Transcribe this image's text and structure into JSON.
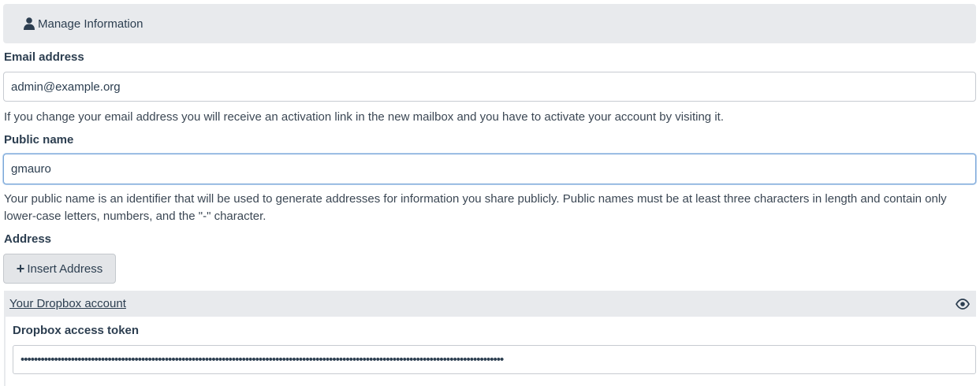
{
  "header": {
    "title": "Manage Information",
    "icon": "user-icon"
  },
  "email": {
    "label": "Email address",
    "value": "admin@example.org",
    "help": "If you change your email address you will receive an activation link in the new mailbox and you have to activate your account by visiting it."
  },
  "public_name": {
    "label": "Public name",
    "value": "gmauro",
    "help": "Your public name is an identifier that will be used to generate addresses for information you share publicly. Public names must be at least three characters in length and contain only lower-case letters, numbers, and the \"-\" character."
  },
  "address": {
    "label": "Address",
    "insert_button": "Insert Address",
    "insert_icon": "plus-icon"
  },
  "dropbox": {
    "link": "Your Dropbox account",
    "toggle_icon": "eye-icon",
    "token_label": "Dropbox access token",
    "token_value": "••••••••••••••••••••••••••••••••••••••••••••••••••••••••••••••••••••••••••••••••••••••••••••••••••••••••••••••••••••••••••••••••••••••••••••••••"
  },
  "colors": {
    "header_bg": "#e8eaed",
    "text": "#2c3e50",
    "focus_border": "#7aa7d8"
  }
}
